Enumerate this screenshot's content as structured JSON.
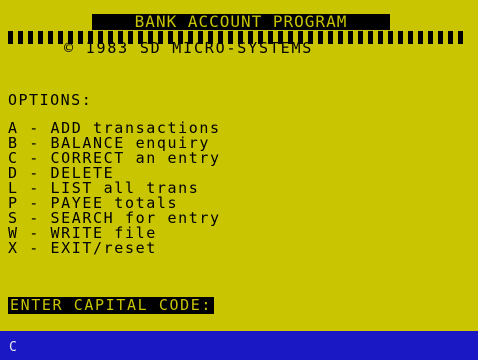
{
  "header": {
    "title": "BANK ACCOUNT PROGRAM",
    "copyright": "© 1983 SD MICRO-SYSTEMS"
  },
  "menu": {
    "heading": "OPTIONS:",
    "items": [
      {
        "label": "A - ADD transactions"
      },
      {
        "label": "B - BALANCE enquiry"
      },
      {
        "label": "C - CORRECT an entry"
      },
      {
        "label": "D - DELETE"
      },
      {
        "label": "L - LIST all trans"
      },
      {
        "label": "P - PAYEE totals"
      },
      {
        "label": "S - SEARCH for entry"
      },
      {
        "label": "W - WRITE file"
      },
      {
        "label": "X - EXIT/reset"
      }
    ]
  },
  "prompt": {
    "text": "ENTER CAPITAL CODE:"
  },
  "input": {
    "cursor": "C"
  },
  "colors": {
    "background": "#c9c500",
    "ink": "#000000",
    "input_strip": "#1a17c4",
    "cursor": "#e8e8e8"
  }
}
